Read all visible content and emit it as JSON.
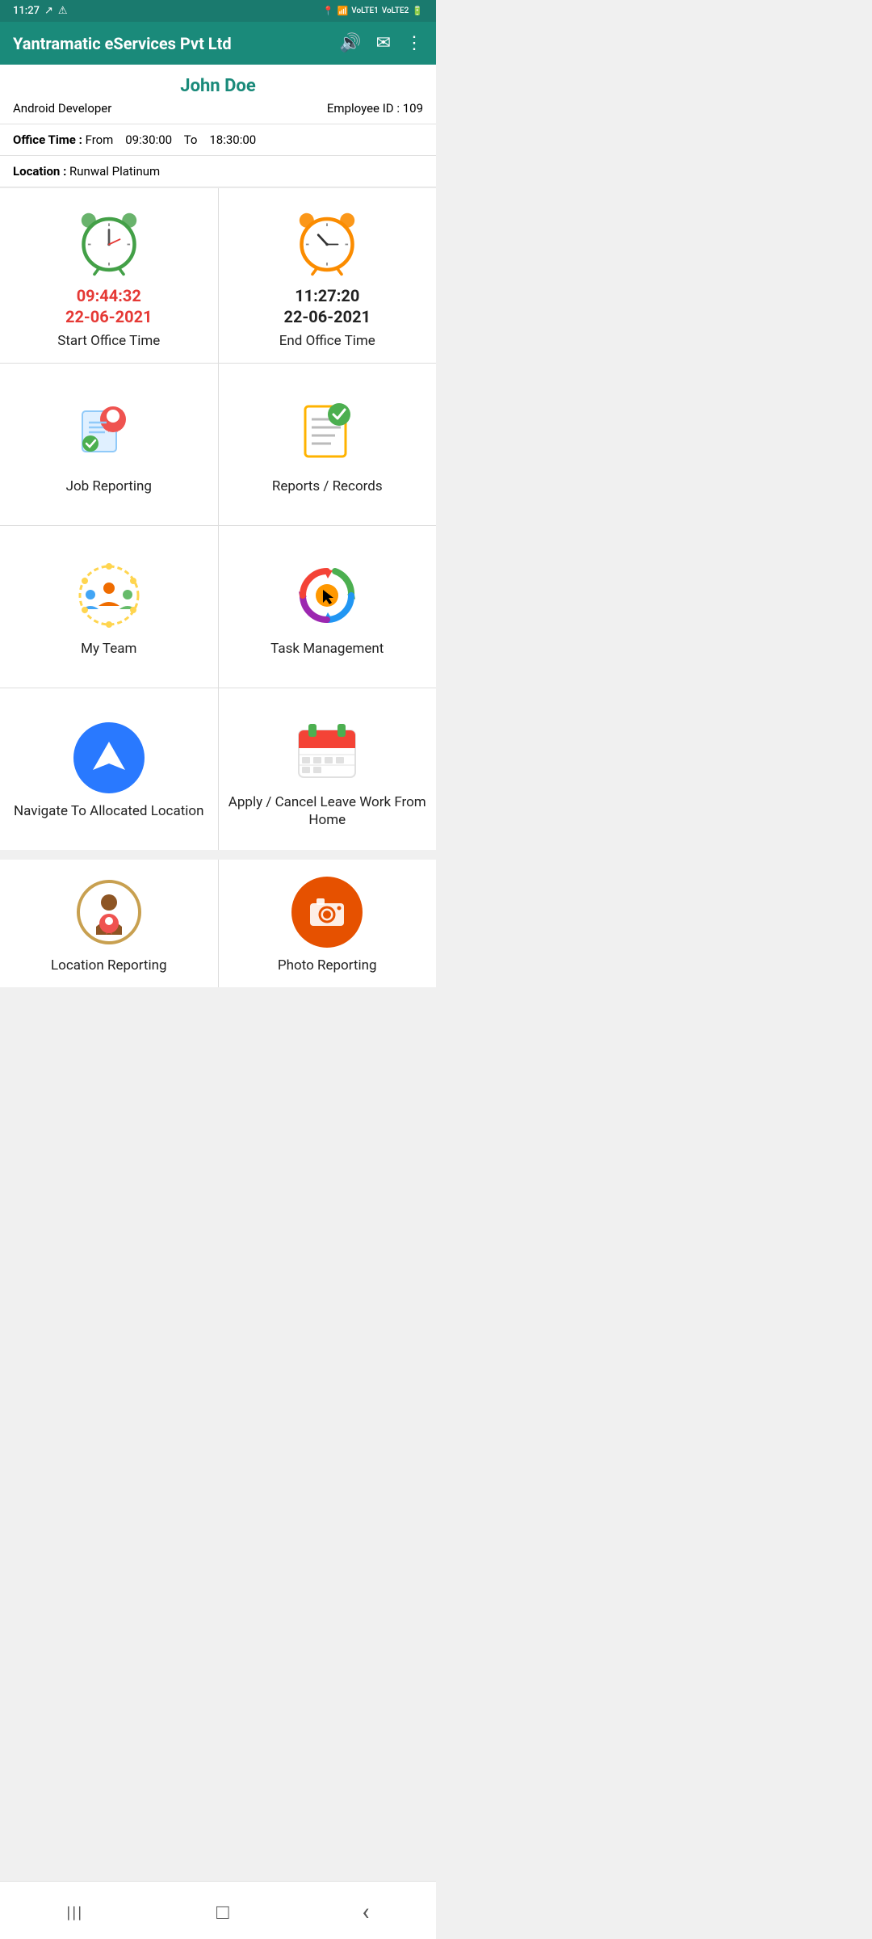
{
  "statusBar": {
    "time": "11:27",
    "icons": [
      "signal",
      "wifi",
      "lte1",
      "lte2",
      "battery"
    ]
  },
  "header": {
    "title": "Yantramatic eServices Pvt Ltd",
    "icons": [
      "speaker-icon",
      "mail-icon",
      "more-icon"
    ]
  },
  "profile": {
    "name": "John Doe",
    "role": "Android Developer",
    "employeeLabel": "Employee ID : ",
    "employeeId": "109"
  },
  "officeTime": {
    "label": "Office Time : ",
    "from": "From",
    "fromTime": "09:30:00",
    "to": "To",
    "toTime": "18:30:00"
  },
  "location": {
    "label": "Location : ",
    "value": "Runwal Platinum"
  },
  "startOffice": {
    "time": "09:44:32",
    "date": "22-06-2021",
    "label": "Start Office Time"
  },
  "endOffice": {
    "time": "11:27:20",
    "date": "22-06-2021",
    "label": "End Office Time"
  },
  "menuItems": [
    {
      "id": "job-reporting",
      "label": "Job Reporting"
    },
    {
      "id": "reports-records",
      "label": "Reports / Records"
    },
    {
      "id": "my-team",
      "label": "My Team"
    },
    {
      "id": "task-management",
      "label": "Task Management"
    },
    {
      "id": "navigate-location",
      "label": "Navigate To Allocated Location"
    },
    {
      "id": "apply-leave",
      "label": "Apply / Cancel Leave Work From Home"
    }
  ],
  "bottomItems": [
    {
      "id": "location-reporting",
      "label": "Location Reporting"
    },
    {
      "id": "photo-reporting",
      "label": "Photo Reporting"
    }
  ],
  "navBar": {
    "recentApps": "|||",
    "home": "□",
    "back": "‹"
  }
}
